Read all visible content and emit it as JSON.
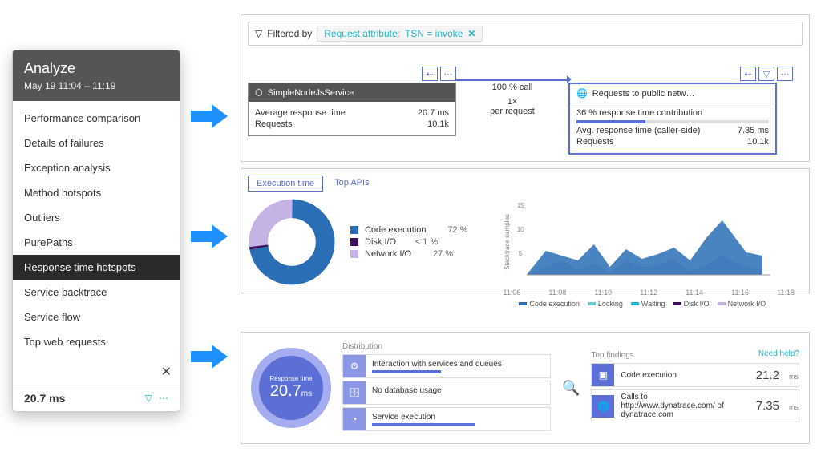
{
  "analyze": {
    "title": "Analyze",
    "time_range": "May 19 11:04 – 11:19",
    "items": [
      "Performance comparison",
      "Details of failures",
      "Exception analysis",
      "Method hotspots",
      "Outliers",
      "PurePaths",
      "Response time hotspots",
      "Service backtrace",
      "Service flow",
      "Top web requests"
    ],
    "active_index": 6,
    "bottom_value": "20.7 ms"
  },
  "filter": {
    "label": "Filtered by",
    "chip_prefix": "Request attribute:",
    "chip_value": "TSN = invoke"
  },
  "source_service": {
    "name": "SimpleNodeJsService",
    "avg_resp_label": "Average response time",
    "avg_resp_value": "20.7 ms",
    "req_label": "Requests",
    "req_value": "10.1k"
  },
  "call_edge": {
    "pct": "100 % call",
    "per": "1×",
    "per_label": "per request"
  },
  "target_service": {
    "name": "Requests to public netw…",
    "contrib": "36 % response time contribution",
    "avg_label": "Avg. response time (caller-side)",
    "avg_value": "7.35 ms",
    "req_label": "Requests",
    "req_value": "10.1k"
  },
  "tabs": {
    "exec": "Execution time",
    "apis": "Top APIs"
  },
  "donut_legend": {
    "code": {
      "label": "Code execution",
      "value": "72 %",
      "color": "#2a6fb5"
    },
    "disk": {
      "label": "Disk I/O",
      "value": "< 1 %",
      "color": "#3b0f5a"
    },
    "net": {
      "label": "Network I/O",
      "value": "27 %",
      "color": "#c6b3e6"
    }
  },
  "area_chart": {
    "ylabel": "Stacktrace samples",
    "ticks": [
      "11:06",
      "11:08",
      "11:10",
      "11:12",
      "11:14",
      "11:16",
      "11:18"
    ],
    "legend": [
      "Code execution",
      "Locking",
      "Waiting",
      "Disk I/O",
      "Network I/O"
    ],
    "colors": [
      "#2a6fb5",
      "#6ec9d6",
      "#1fb6c9",
      "#3b0f5a",
      "#c6b3e6"
    ],
    "ymax": 15
  },
  "distribution": {
    "title": "Distribution",
    "circle_label": "Response time",
    "circle_value": "20.7",
    "circle_unit": "ms",
    "rows": [
      "Interaction with services and queues",
      "No database usage",
      "Service execution"
    ]
  },
  "findings": {
    "title": "Top findings",
    "help": "Need help?",
    "rows": [
      {
        "label": "Code execution",
        "value": "21.2",
        "unit": "ms"
      },
      {
        "label": "Calls to http://www.dynatrace.com/ of dynatrace.com",
        "value": "7.35",
        "unit": "ms"
      }
    ]
  },
  "chart_data": [
    {
      "type": "pie",
      "title": "Execution time breakdown",
      "series": [
        {
          "name": "Code execution",
          "value": 72
        },
        {
          "name": "Disk I/O",
          "value": 1
        },
        {
          "name": "Network I/O",
          "value": 27
        }
      ]
    },
    {
      "type": "area",
      "title": "Stacktrace samples over time",
      "ylabel": "Stacktrace samples",
      "ylim": [
        0,
        15
      ],
      "x": [
        "11:06",
        "11:07",
        "11:08",
        "11:09",
        "11:10",
        "11:11",
        "11:12",
        "11:13",
        "11:14",
        "11:15",
        "11:16",
        "11:17",
        "11:18",
        "11:19"
      ],
      "series": [
        {
          "name": "Code execution",
          "values": [
            3,
            6,
            5,
            4,
            7,
            3,
            6,
            4,
            5,
            6,
            4,
            8,
            11,
            5
          ]
        },
        {
          "name": "Network I/O",
          "values": [
            1,
            2,
            3,
            1,
            2,
            1,
            3,
            2,
            2,
            3,
            1,
            2,
            4,
            2
          ]
        }
      ]
    }
  ]
}
